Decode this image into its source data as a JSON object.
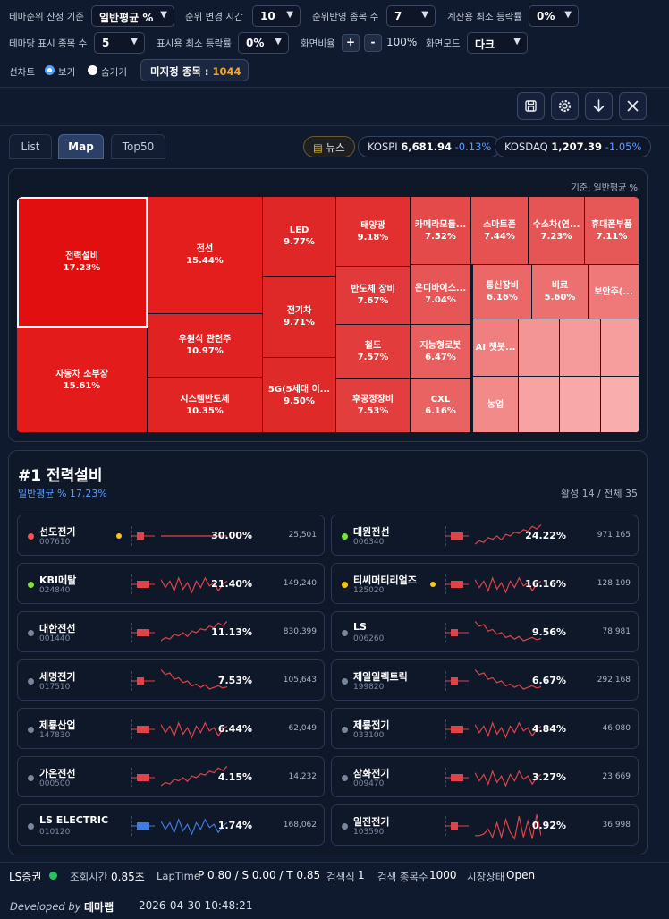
{
  "controls": {
    "theme_rank_basis": {
      "label": "테마순위 산정 기준",
      "value": "일반평균 %"
    },
    "rank_change_time": {
      "label": "순위 변경 시간",
      "value": "10"
    },
    "rank_stock_count": {
      "label": "순위반영 종목 수",
      "value": "7"
    },
    "calc_min_rate": {
      "label": "계산용 최소 등락률",
      "value": "0%"
    },
    "stocks_per_theme": {
      "label": "테마당 표시 종목 수",
      "value": "5"
    },
    "display_min_rate": {
      "label": "표시용 최소 등락률",
      "value": "0%"
    },
    "zoom": {
      "label": "화면비율",
      "plus": "+",
      "minus": "-",
      "value": "100%"
    },
    "mode": {
      "label": "화면모드",
      "value": "다크"
    },
    "preview": {
      "label": "선차트",
      "show": "보기",
      "hide": "숨기기",
      "selected": "보기"
    },
    "unassigned": {
      "label": "미지정 종목 :",
      "count": "1044"
    }
  },
  "toolbar": {
    "icons": [
      "save-icon",
      "gear-icon",
      "arrow-down-icon",
      "close-icon"
    ]
  },
  "tabs": [
    {
      "label": "List",
      "active": false
    },
    {
      "label": "Map",
      "active": true
    },
    {
      "label": "Top50",
      "active": false
    }
  ],
  "news": {
    "label": "뉴스"
  },
  "indices": [
    {
      "name": "KOSPI",
      "value": "6,681.94",
      "change": "-0.13%"
    },
    {
      "name": "KOSDAQ",
      "value": "1,207.39",
      "change": "-1.05%"
    }
  ],
  "map": {
    "basis": "기준: 일반평균 %",
    "tiles": [
      {
        "name": "전력설비",
        "value": "17.23%",
        "color": "#e20f10",
        "selected": true
      },
      {
        "name": "자동차 소부장",
        "value": "15.61%",
        "color": "#e41b1b"
      },
      {
        "name": "전선",
        "value": "15.44%",
        "color": "#e41d1d"
      },
      {
        "name": "우원식 관련주",
        "value": "10.97%",
        "color": "#e12222"
      },
      {
        "name": "시스템반도체",
        "value": "10.35%",
        "color": "#e12424"
      },
      {
        "name": "LED",
        "value": "9.77%",
        "color": "#df2727"
      },
      {
        "name": "전기차",
        "value": "9.71%",
        "color": "#df2828"
      },
      {
        "name": "5G(5세대 이...",
        "value": "9.50%",
        "color": "#df2a2a"
      },
      {
        "name": "태양광",
        "value": "9.18%",
        "color": "#e23030"
      },
      {
        "name": "반도체 장비",
        "value": "7.67%",
        "color": "#e23a3a"
      },
      {
        "name": "철도",
        "value": "7.57%",
        "color": "#e23c3c"
      },
      {
        "name": "후공정장비",
        "value": "7.53%",
        "color": "#e23e3e"
      },
      {
        "name": "카메라모듈...",
        "value": "7.52%",
        "color": "#e44a4a"
      },
      {
        "name": "온디바이스...",
        "value": "7.04%",
        "color": "#e65656"
      },
      {
        "name": "지능형로봇",
        "value": "6.47%",
        "color": "#e95f5f"
      },
      {
        "name": "CXL",
        "value": "6.16%",
        "color": "#e96363"
      },
      {
        "name": "스마트폰",
        "value": "7.44%",
        "color": "#e65252"
      },
      {
        "name": "수소차(연...",
        "value": "7.23%",
        "color": "#e65555"
      },
      {
        "name": "휴대폰부품",
        "value": "7.11%",
        "color": "#e65858"
      },
      {
        "name": "통신장비",
        "value": "6.16%",
        "color": "#ec6868"
      },
      {
        "name": "비료",
        "value": "5.60%",
        "color": "#ed7070"
      },
      {
        "name": "보안주(...",
        "value": "",
        "color": "#ef7878"
      },
      {
        "name": "AI 챗봇...",
        "value": "",
        "color": "#f08080"
      },
      {
        "name": "농업",
        "value": "",
        "color": "#f28a8a"
      },
      {
        "name": "",
        "value": "",
        "color": "#f49595"
      },
      {
        "name": "",
        "value": "",
        "color": "#f59b9b"
      },
      {
        "name": "",
        "value": "",
        "color": "#f69e9e"
      },
      {
        "name": "",
        "value": "",
        "color": "#f7a3a3"
      },
      {
        "name": "",
        "value": "",
        "color": "#f8a8a8"
      },
      {
        "name": "",
        "value": "",
        "color": "#f9adad"
      }
    ]
  },
  "detail": {
    "title": "#1 전력설비",
    "subtitle": "일반평균 % 17.23%",
    "stats": "활성 14 / 전체 35",
    "stocks": [
      {
        "name": "선도전기",
        "code": "007610",
        "pct": "30.00%",
        "vol": "25,501",
        "dot": "#ff4d4d",
        "flag": true,
        "spark": "flat",
        "color": "#e0434a"
      },
      {
        "name": "대원전선",
        "code": "006340",
        "pct": "24.22%",
        "vol": "971,165",
        "dot": "#7ee23a",
        "flag": false,
        "spark": "up",
        "color": "#e0434a"
      },
      {
        "name": "KBI메탈",
        "code": "024840",
        "pct": "21.40%",
        "vol": "149,240",
        "dot": "#7ee23a",
        "flag": false,
        "spark": "mixed",
        "color": "#e0434a"
      },
      {
        "name": "티씨머티리얼즈",
        "code": "125020",
        "pct": "16.16%",
        "vol": "128,109",
        "dot": "#f5c518",
        "flag": true,
        "spark": "mixed",
        "color": "#e0434a"
      },
      {
        "name": "대한전선",
        "code": "001440",
        "pct": "11.13%",
        "vol": "830,399",
        "dot": "#7b8599",
        "flag": false,
        "spark": "up",
        "color": "#e0434a"
      },
      {
        "name": "LS",
        "code": "006260",
        "pct": "9.56%",
        "vol": "78,981",
        "dot": "#7b8599",
        "flag": false,
        "spark": "down",
        "color": "#e0434a"
      },
      {
        "name": "세명전기",
        "code": "017510",
        "pct": "7.53%",
        "vol": "105,643",
        "dot": "#7b8599",
        "flag": false,
        "spark": "down",
        "color": "#e0434a"
      },
      {
        "name": "제일일렉트릭",
        "code": "199820",
        "pct": "6.67%",
        "vol": "292,168",
        "dot": "#7b8599",
        "flag": false,
        "spark": "down",
        "color": "#e0434a"
      },
      {
        "name": "제룡산업",
        "code": "147830",
        "pct": "6.44%",
        "vol": "62,049",
        "dot": "#7b8599",
        "flag": false,
        "spark": "mixed",
        "color": "#e0434a"
      },
      {
        "name": "제룡전기",
        "code": "033100",
        "pct": "4.84%",
        "vol": "46,080",
        "dot": "#7b8599",
        "flag": false,
        "spark": "mixed",
        "color": "#e0434a"
      },
      {
        "name": "가온전선",
        "code": "000500",
        "pct": "4.15%",
        "vol": "14,232",
        "dot": "#7b8599",
        "flag": false,
        "spark": "up",
        "color": "#e0434a"
      },
      {
        "name": "삼화전기",
        "code": "009470",
        "pct": "3.27%",
        "vol": "23,669",
        "dot": "#7b8599",
        "flag": false,
        "spark": "mixed",
        "color": "#e0434a"
      },
      {
        "name": "LS ELECTRIC",
        "code": "010120",
        "pct": "1.74%",
        "vol": "168,062",
        "dot": "#7b8599",
        "flag": false,
        "spark": "mixed",
        "color": "#3f7be0"
      },
      {
        "name": "일진전기",
        "code": "103590",
        "pct": "0.92%",
        "vol": "36,998",
        "dot": "#7b8599",
        "flag": false,
        "spark": "spike",
        "color": "#e0434a"
      }
    ]
  },
  "footer": {
    "broker": "LS증권",
    "query_label": "조회시간",
    "query_value": "0.85초",
    "lap_label": "LapTime",
    "lap_value": "P 0.80 / S 0.00 / T 0.85",
    "search_label": "검색식",
    "search_value": "1",
    "count_label": "검색 종목수",
    "count_value": "1000",
    "market_label": "시장상태",
    "market_value": "Open",
    "developed_by": "Developed by",
    "brand": "테마랩",
    "timestamp": "2026-04-30 10:48:21"
  }
}
